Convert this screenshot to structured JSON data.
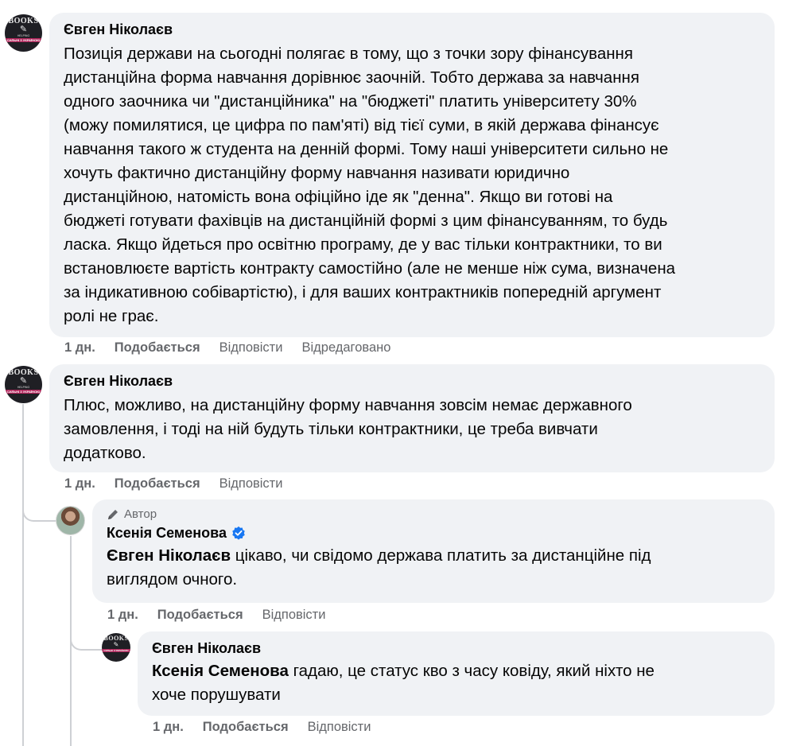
{
  "comments": [
    {
      "author": "Євген Ніколаєв",
      "text": "Позиція держави на сьогодні полягає в тому, що з точки зору фінансування\nдистанційна форма навчання дорівнює заочній. Тобто держава за навчання\nодного заочника чи \"дистанційника\" на \"бюджеті\" платить університету 30%\n(можу помилятися, це цифра по пам'яті) від тієї суми, в якій держава фінансує\nнавчання такого ж студента на денній формі. Тому наші університети сильно не\nхочуть фактично дистанційну форму навчання називати юридично\nдистанційною, натомість вона офіційно іде як \"денна\". Якщо ви готові на\nбюджеті готувати фахівців на дистанційній формі з цим фінансуванням, то будь\nласка. Якщо йдеться про освітню програму, де у вас тільки контрактники, то ви\nвстановлюєте вартість контракту самостійно (але не менше ніж сума, визначена\nза індикативною собівартістю), і для ваших контрактників попередній аргумент\nролі не грає.",
      "time": "1 дн.",
      "like": "Подобається",
      "reply": "Відповісти",
      "edited": "Відредаговано"
    },
    {
      "author": "Євген Ніколаєв",
      "text": "Плюс, можливо, на дистанційну форму навчання зовсім немає державного\nзамовлення, і тоді на ній будуть тільки контрактники, це треба вивчати\nдодатково.",
      "time": "1 дн.",
      "like": "Подобається",
      "reply": "Відповісти"
    },
    {
      "badge": "Автор",
      "author": "Ксенія Семенова",
      "mention": "Євген Ніколаєв",
      "text": " цікаво, чи свідомо держава платить за дистанційне під\nвиглядом очного.",
      "time": "1 дн.",
      "like": "Подобається",
      "reply": "Відповісти"
    },
    {
      "author": "Євген Ніколаєв",
      "mention": "Ксенія Семенова",
      "text": " гадаю, це статус кво з часу ковіду, який ніхто не\nхоче порушувати",
      "time": "1 дн.",
      "like": "Подобається",
      "reply": "Відповісти"
    }
  ],
  "avatar_books": {
    "title": "BOOKS",
    "line1": "HELPING",
    "line2": "INTROVERTS",
    "band": "СИЛЬНІ З УКРАЇНОЮ"
  },
  "colors": {
    "bubble": "#f0f2f5",
    "meta": "#65676b",
    "verified": "#1877f2",
    "thread_line": "#ced0d4"
  },
  "icons": {
    "badge": "pencil-icon",
    "verified": "verified-badge-icon"
  }
}
